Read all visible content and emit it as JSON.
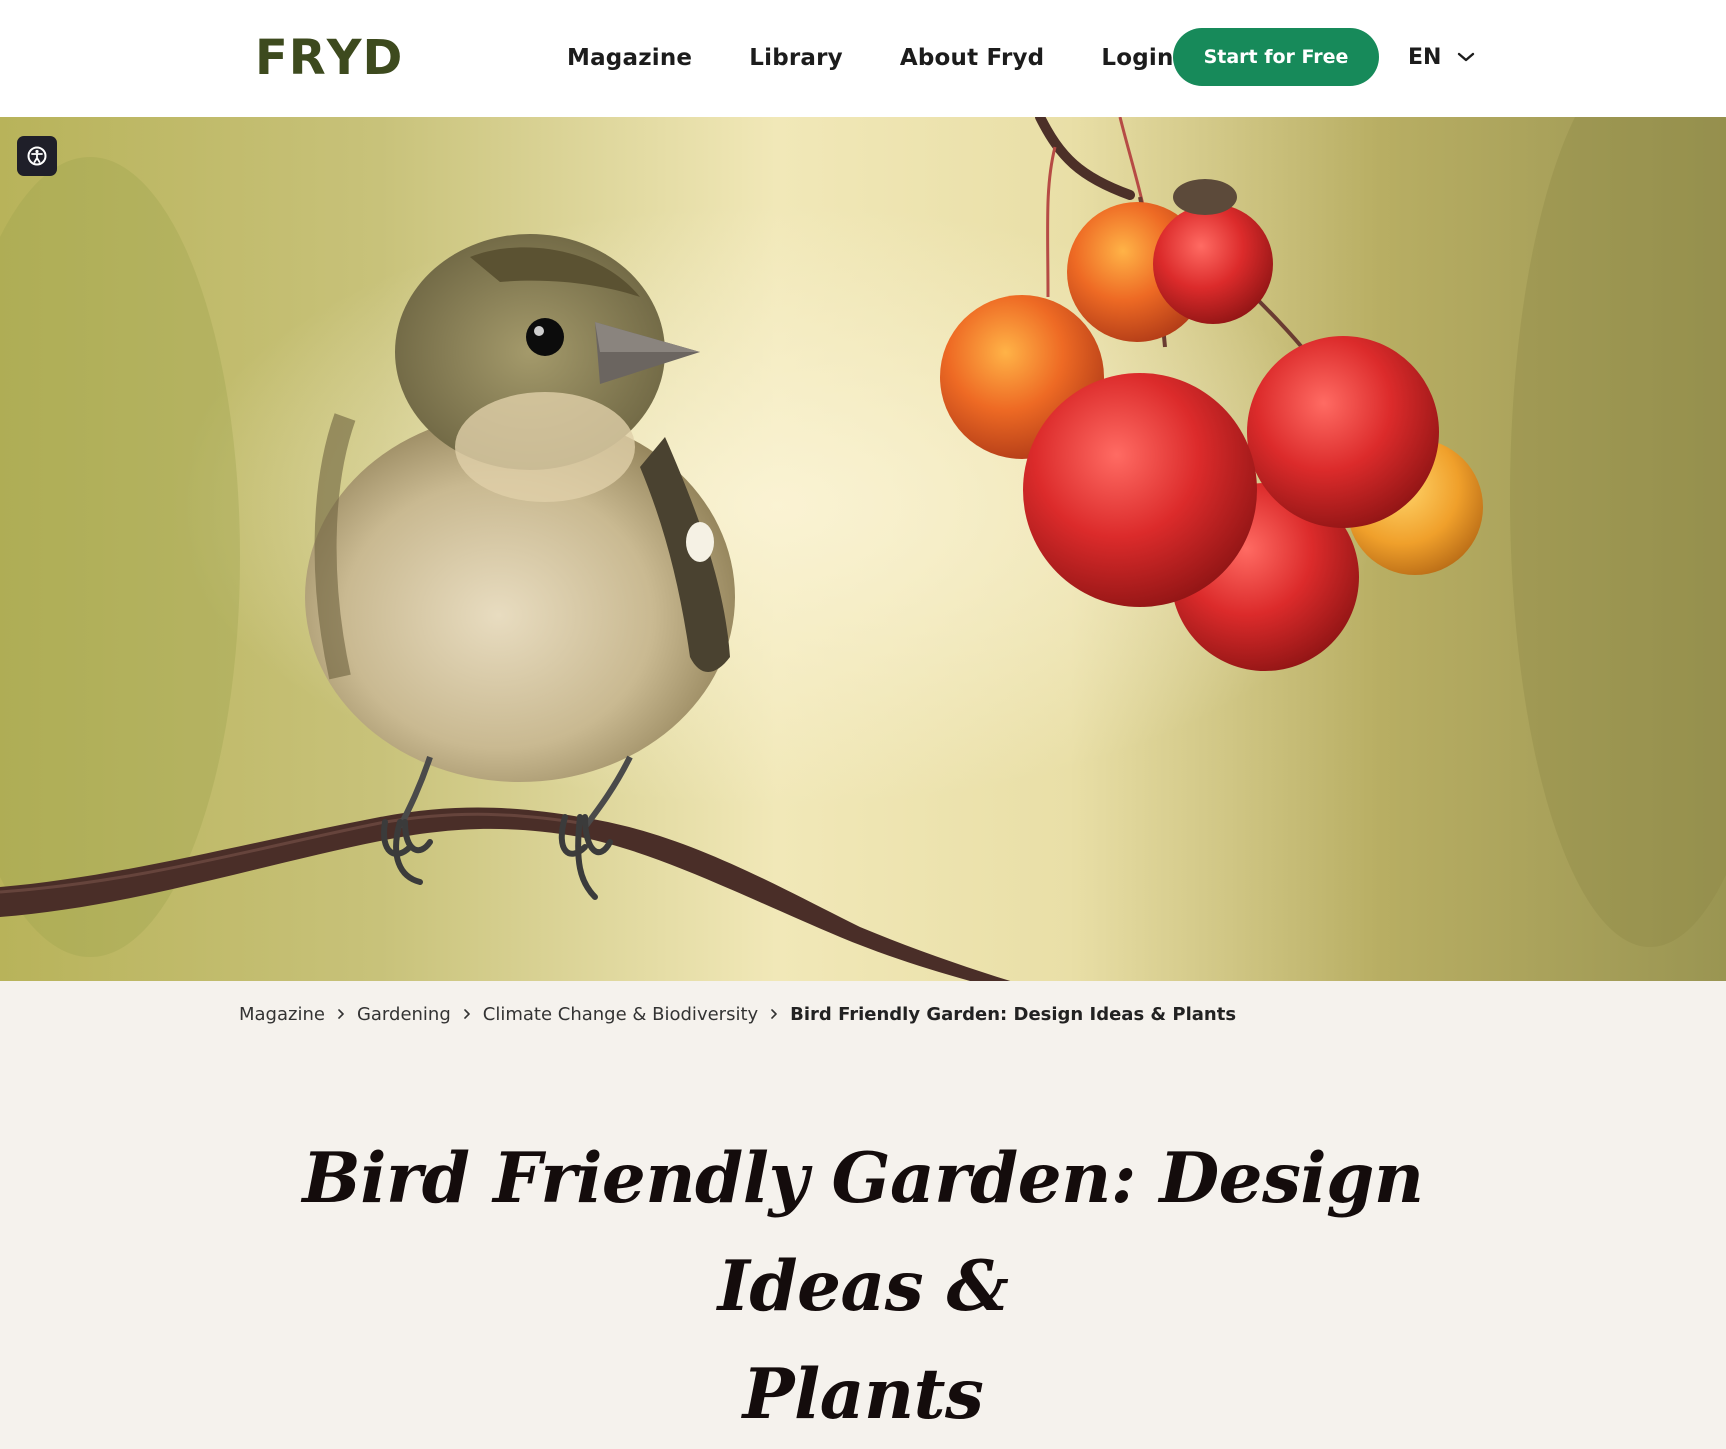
{
  "brand": {
    "logo_left": "FR",
    "logo_mid": "Y",
    "logo_right": "D",
    "logo_color": "#3d4a1e"
  },
  "nav": {
    "items": [
      {
        "label": "Magazine"
      },
      {
        "label": "Library"
      },
      {
        "label": "About Fryd"
      },
      {
        "label": "Login"
      }
    ],
    "cta_label": "Start for Free",
    "cta_color": "#178a5a",
    "language": "EN",
    "language_icon": "chevron-down-icon"
  },
  "hero": {
    "image_subject": "bird-on-branch-with-berries-photo",
    "accessibility_icon": "accessibility-icon"
  },
  "breadcrumb": {
    "items": [
      {
        "label": "Magazine"
      },
      {
        "label": "Gardening"
      },
      {
        "label": "Climate Change & Biodiversity"
      }
    ],
    "current": "Bird Friendly Garden: Design Ideas & Plants",
    "separator_icon": "chevron-right-icon"
  },
  "article": {
    "title_line1": "Bird Friendly Garden: Design Ideas &",
    "title_line2": "Plants"
  }
}
